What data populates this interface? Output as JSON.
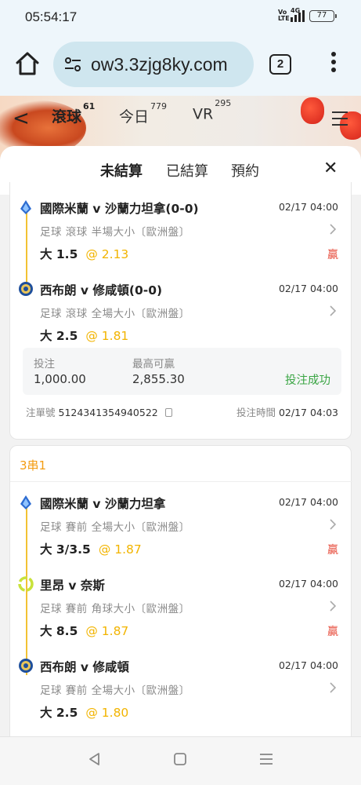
{
  "status_bar": {
    "time": "05:54:17",
    "network": "4G",
    "volte": "Vo LTE",
    "battery": "77"
  },
  "browser": {
    "url": "ow3.3zjg8ky.com",
    "tab_count": "2"
  },
  "game_nav": {
    "tabs": [
      {
        "label": "滾球",
        "count": "61"
      },
      {
        "label": "今日",
        "count": "779"
      },
      {
        "label": "VR",
        "count": "295"
      }
    ]
  },
  "sheet": {
    "tabs": [
      "未結算",
      "已結算",
      "預約"
    ],
    "active_tab": "未結算"
  },
  "bet1": {
    "legs": [
      {
        "match": "國際米蘭 v 沙蘭力坦拿(0-0)",
        "time": "02/17 04:00",
        "market": "足球  滾球  半場大小〔歐洲盤〕",
        "pick": "大 1.5",
        "odds": "@ 2.13",
        "result": "贏",
        "icon": "serie-a-icon"
      },
      {
        "match": "西布朗 v 修咸頓(0-0)",
        "time": "02/17 04:00",
        "market": "足球  滾球  全場大小〔歐洲盤〕",
        "pick": "大 2.5",
        "odds": "@ 1.81",
        "result": "",
        "icon": "championship-icon"
      }
    ],
    "stake_label": "投注",
    "stake": "1,000.00",
    "max_win_label": "最高可贏",
    "max_win": "2,855.30",
    "status": "投注成功",
    "order_label": "注單號",
    "order_no": "5124341354940522",
    "bet_time_label": "投注時間",
    "bet_time": "02/17 04:03"
  },
  "bet2": {
    "type": "3串1",
    "legs": [
      {
        "match": "國際米蘭 v 沙蘭力坦拿",
        "time": "02/17 04:00",
        "market": "足球  賽前  全場大小〔歐洲盤〕",
        "pick": "大 3/3.5",
        "odds": "@ 1.87",
        "result": "贏",
        "icon": "serie-a-icon"
      },
      {
        "match": "里昂 v 奈斯",
        "time": "02/17 04:00",
        "market": "足球  賽前  角球大小〔歐洲盤〕",
        "pick": "大 8.5",
        "odds": "@ 1.87",
        "result": "贏",
        "icon": "ligue-1-icon"
      },
      {
        "match": "西布朗 v 修咸頓",
        "time": "02/17 04:00",
        "market": "足球  賽前  全場大小〔歐洲盤〕",
        "pick": "大 2.5",
        "odds": "@ 1.80",
        "result": "",
        "icon": "championship-icon"
      }
    ]
  },
  "colors": {
    "accent": "#f2b400",
    "win": "#e74c3c",
    "success": "#3aa544",
    "parlay": "#f39c12"
  }
}
